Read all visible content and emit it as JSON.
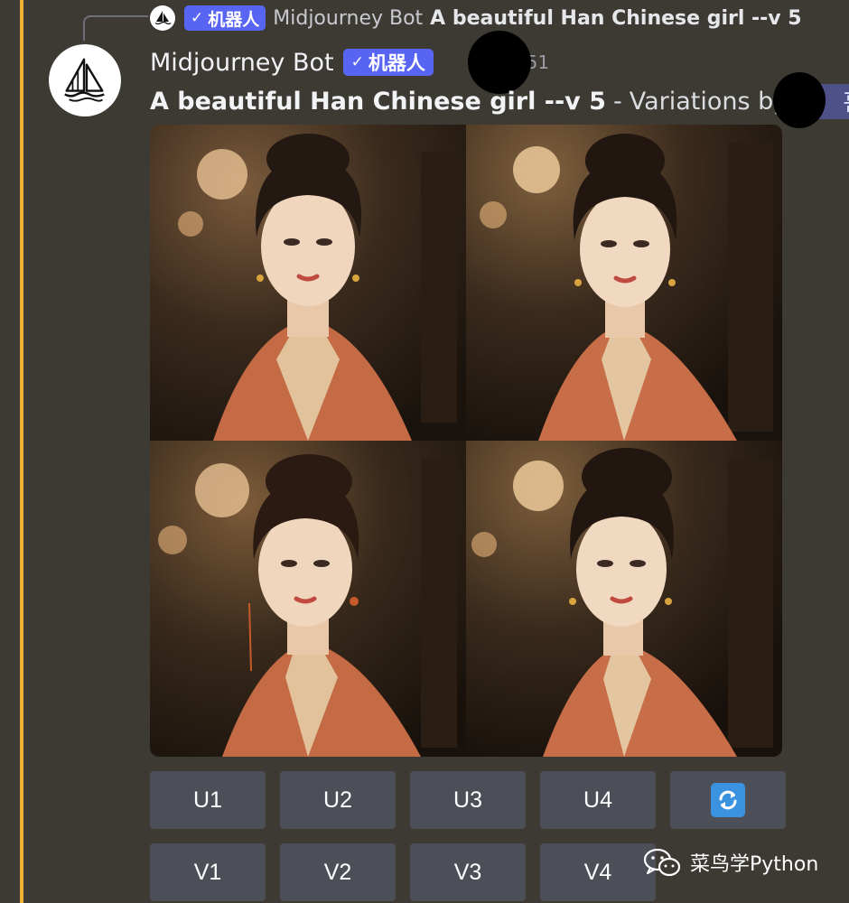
{
  "reply": {
    "badge_label": "机器人",
    "bot_name": "Midjourney Bot",
    "prompt": "A beautiful Han Chinese girl --v 5"
  },
  "message": {
    "username": "Midjourney Bot",
    "badge_label": "机器人",
    "timestamp": ":51",
    "prompt": "A beautiful Han Chinese girl --v 5",
    "separator": "-",
    "variations_text": "Variations by",
    "mention_tail": "哥"
  },
  "images": [
    {
      "name": "variation-1"
    },
    {
      "name": "variation-2"
    },
    {
      "name": "variation-3"
    },
    {
      "name": "variation-4"
    }
  ],
  "buttons": {
    "upscale": [
      "U1",
      "U2",
      "U3",
      "U4"
    ],
    "variation": [
      "V1",
      "V2",
      "V3",
      "V4"
    ],
    "reroll_icon": "refresh-icon"
  },
  "watermark": {
    "text": "菜鸟学Python",
    "icon": "wechat-icon"
  },
  "colors": {
    "background": "#3d3a34",
    "accent_bar": "#f0b232",
    "badge": "#5865f2",
    "button": "#4c4f57",
    "mention": "#4e5187"
  }
}
